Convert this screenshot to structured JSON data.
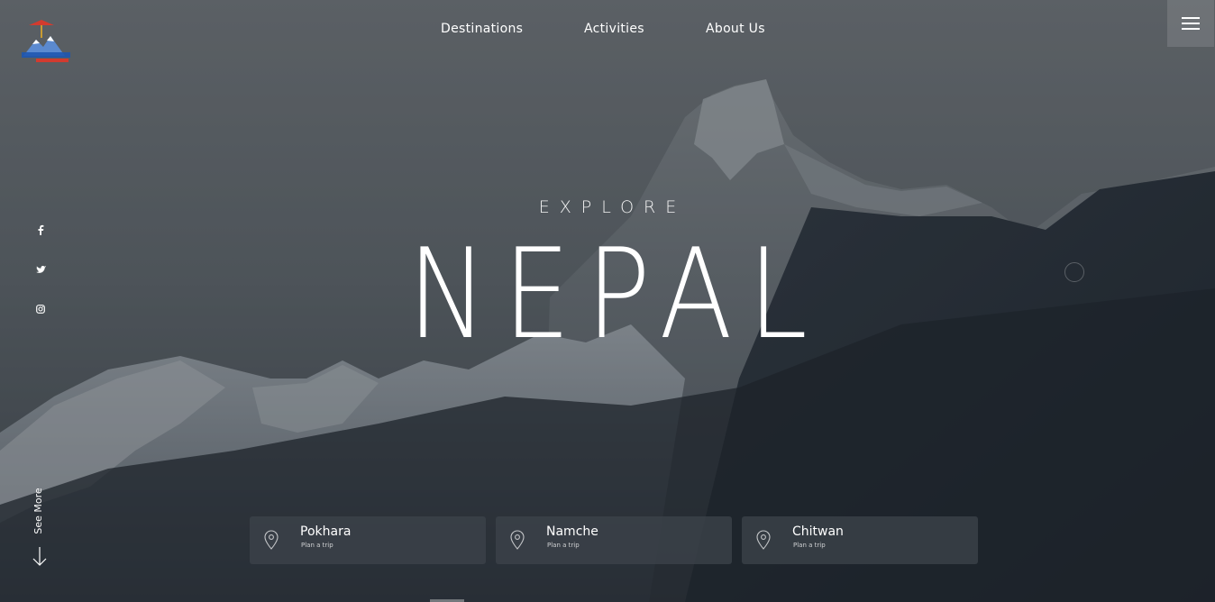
{
  "brand": {
    "logo_icon": "visit-nepal-logo"
  },
  "nav": {
    "items": [
      {
        "label": "Destinations"
      },
      {
        "label": "Activities"
      },
      {
        "label": "About Us"
      }
    ],
    "menu_icon": "hamburger-icon"
  },
  "social": [
    {
      "icon": "facebook-icon",
      "glyph": "f"
    },
    {
      "icon": "twitter-icon",
      "glyph": "t"
    },
    {
      "icon": "instagram-icon",
      "glyph": "ig"
    }
  ],
  "hero": {
    "eyebrow": "EXPLORE",
    "title": "NEPAL"
  },
  "see_more": {
    "label": "See More",
    "icon": "arrow-down-icon"
  },
  "destinations": [
    {
      "name": "Pokhara",
      "sub": "Plan a trip",
      "icon": "location-pin-icon"
    },
    {
      "name": "Namche",
      "sub": "Plan a trip",
      "icon": "location-pin-icon"
    },
    {
      "name": "Chitwan",
      "sub": "Plan a trip",
      "icon": "location-pin-icon"
    }
  ],
  "colors": {
    "overlay": "#2a2f36",
    "card_bg": "#3c424a",
    "text": "#ffffff"
  }
}
